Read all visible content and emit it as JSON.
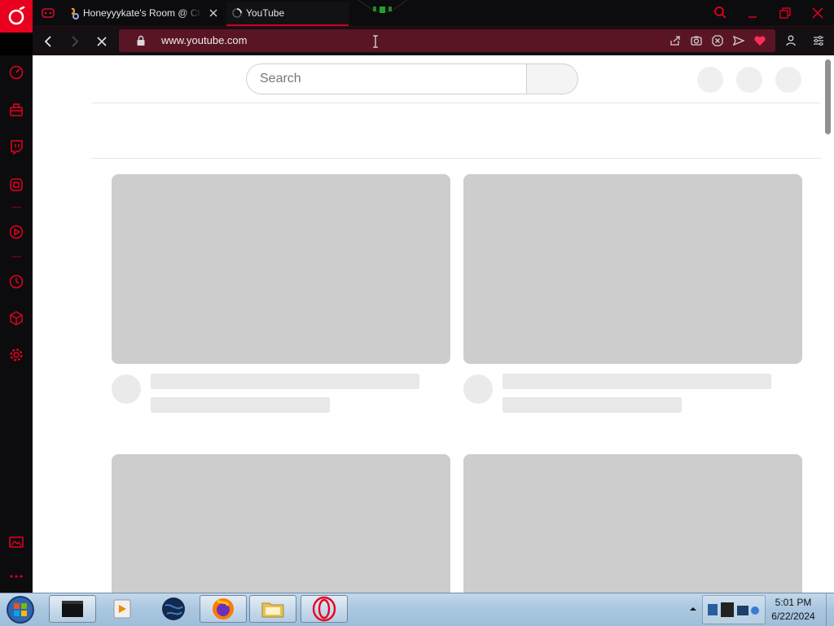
{
  "browser": {
    "tabs": [
      {
        "title": "Honeyyykate's Room @ Ch",
        "active": false
      },
      {
        "title": "YouTube",
        "active": true
      }
    ],
    "url": "www.youtube.com",
    "accent_color": "#e8001e"
  },
  "icons": {
    "sidebar": [
      "speed-dial-icon",
      "gx-control-icon",
      "twitch-icon",
      "instagram-icon",
      "player-icon",
      "history-icon",
      "extensions-icon",
      "settings-icon",
      "wallpaper-icon",
      "more-icon"
    ],
    "address_bar": [
      "share-icon",
      "snapshot-icon",
      "adblock-icon",
      "send-icon",
      "heart-icon",
      "account-icon",
      "easy-setup-icon"
    ]
  },
  "page": {
    "search_placeholder": "Search",
    "state": "loading skeleton"
  },
  "taskbar": {
    "apps": [
      "terminal-app",
      "media-player-app",
      "globe-app",
      "firefox-app",
      "file-explorer-app",
      "opera-app"
    ],
    "time": "5:01 PM",
    "date": "6/22/2024"
  }
}
